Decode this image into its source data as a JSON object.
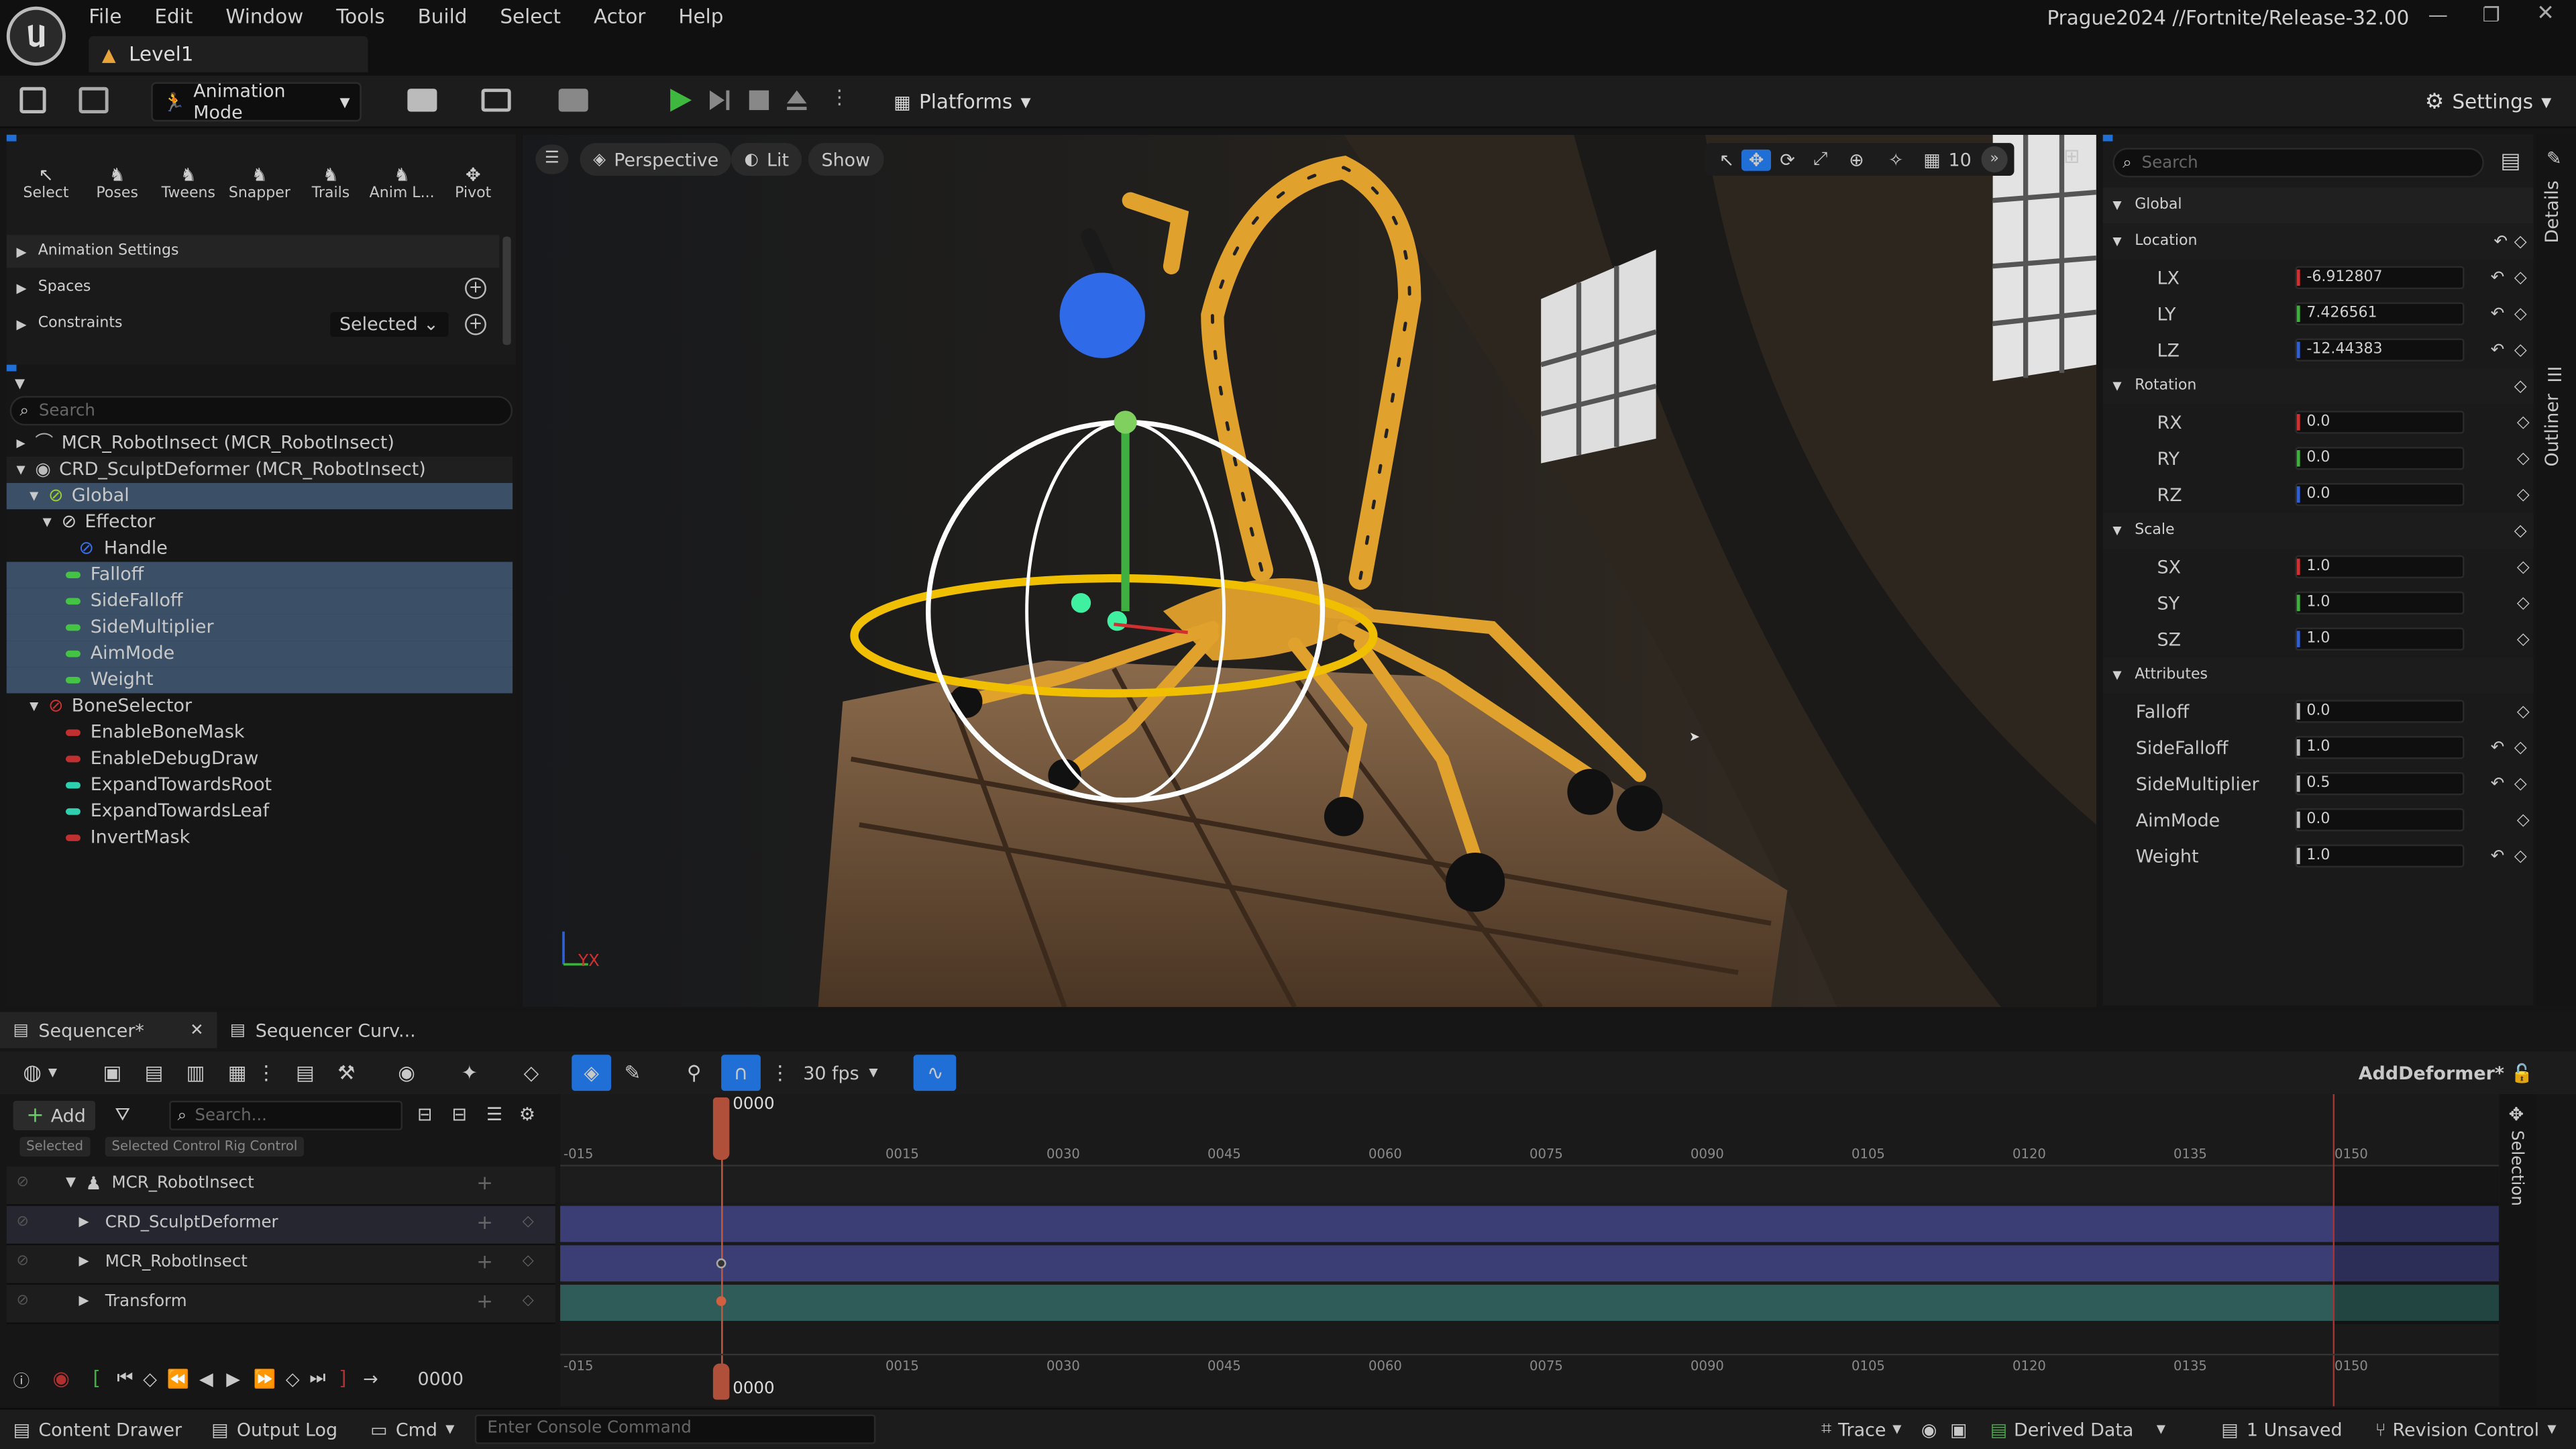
{
  "app": {
    "project_title": "Prague2024 //Fortnite/Release-32.00",
    "menu": [
      "File",
      "Edit",
      "Window",
      "Tools",
      "Build",
      "Select",
      "Actor",
      "Help"
    ],
    "level_tab": "Level1"
  },
  "toolbar": {
    "mode": "Animation Mode",
    "platforms": "Platforms",
    "settings": "Settings"
  },
  "anim_tools": {
    "tools": [
      "Select",
      "Poses",
      "Tweens",
      "Snapper",
      "Trails",
      "Anim L...",
      "Pivot"
    ],
    "sections": {
      "animation_settings": "Animation Settings",
      "spaces": "Spaces",
      "constraints": "Constraints",
      "constraints_value": "Selected"
    }
  },
  "rig_tree": {
    "search_placeholder": "Search",
    "items": [
      "MCR_RobotInsect  (MCR_RobotInsect)",
      "CRD_SculptDeformer  (MCR_RobotInsect)",
      "Global",
      "Effector",
      "Handle",
      "Falloff",
      "SideFalloff",
      "SideMultiplier",
      "AimMode",
      "Weight",
      "BoneSelector",
      "EnableBoneMask",
      "EnableDebugDraw",
      "ExpandTowardsRoot",
      "ExpandTowardsLeaf",
      "InvertMask"
    ]
  },
  "viewport": {
    "perspective": "Perspective",
    "lit": "Lit",
    "show": "Show",
    "grid_value": "10",
    "axis_label": "YX"
  },
  "details": {
    "search_placeholder": "Search",
    "global": "Global",
    "location": "Location",
    "rotation": "Rotation",
    "scale": "Scale",
    "attributes": "Attributes",
    "lx_label": "LX",
    "lx": "-6.912807",
    "ly_label": "LY",
    "ly": "7.426561",
    "lz_label": "LZ",
    "lz": "-12.44383",
    "rx_label": "RX",
    "rx": "0.0",
    "ry_label": "RY",
    "ry": "0.0",
    "rz_label": "RZ",
    "rz": "0.0",
    "sx_label": "SX",
    "sx": "1.0",
    "sy_label": "SY",
    "sy": "1.0",
    "sz_label": "SZ",
    "sz": "1.0",
    "falloff_label": "Falloff",
    "falloff": "0.0",
    "sidefalloff_label": "SideFalloff",
    "sidefalloff": "1.0",
    "sidemultiplier_label": "SideMultiplier",
    "sidemultiplier": "0.5",
    "aimmode_label": "AimMode",
    "aimmode": "0.0",
    "weight_label": "Weight",
    "weight": "1.0",
    "side_tabs": [
      "Details",
      "Outliner"
    ]
  },
  "sequencer": {
    "tab1": "Sequencer*",
    "tab2": "Sequencer Curv...",
    "fps": "30 fps",
    "sequence_name": "AddDeformer*",
    "add": "Add",
    "search_placeholder": "Search...",
    "filter1": "Selected",
    "filter2": "Selected Control Rig Control",
    "current_frame": "0000",
    "playback_frame": "0000",
    "side_tab": "Selection",
    "ticks": [
      "-015",
      "0015",
      "0030",
      "0045",
      "0060",
      "0075",
      "0090",
      "0105",
      "0120",
      "0135",
      "0150"
    ],
    "tracks": [
      "MCR_RobotInsect",
      "CRD_SculptDeformer",
      "MCR_RobotInsect",
      "Transform"
    ]
  },
  "statusbar": {
    "content_drawer": "Content Drawer",
    "output_log": "Output Log",
    "cmd": "Cmd",
    "console_placeholder": "Enter Console Command",
    "trace": "Trace",
    "derived_data": "Derived Data",
    "unsaved": "1 Unsaved",
    "revision_control": "Revision Control"
  },
  "colors": {
    "accent": "#1f6fd6",
    "selection": "#3b4f66",
    "x_axis": "#d03030",
    "y_axis": "#3fb03f",
    "z_axis": "#2f5fd0",
    "track_blue": "#3b3e74",
    "track_teal": "#2f5c58"
  }
}
